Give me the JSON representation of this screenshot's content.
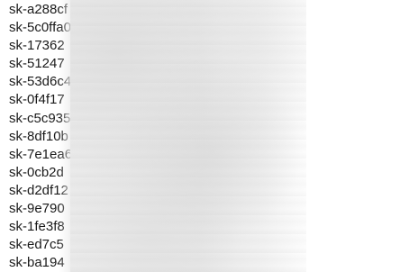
{
  "keys": [
    "sk-a288cf",
    "sk-5c0ffa0",
    "sk-17362",
    "sk-51247",
    "sk-53d6c4",
    "sk-0f4f17",
    "sk-c5c935",
    "sk-8df10b",
    "sk-7e1ea6",
    "sk-0cb2d",
    "sk-d2df12",
    "sk-9e790",
    "sk-1fe3f8",
    "sk-ed7c5",
    "sk-ba194"
  ]
}
